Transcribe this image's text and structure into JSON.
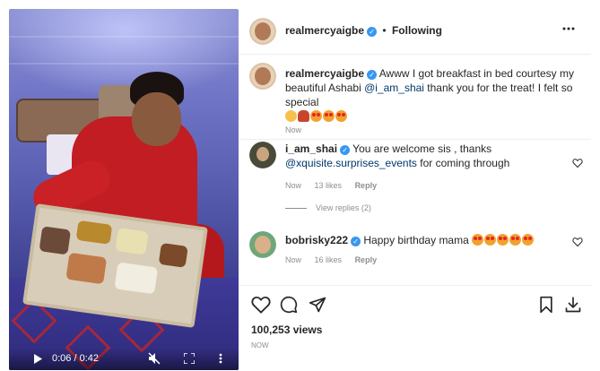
{
  "post": {
    "username": "realmercyaigbe",
    "follow_status": "Following",
    "separator": "•",
    "more_icon": "more-options-icon"
  },
  "caption": {
    "username": "realmercyaigbe",
    "text_before_mention": "Awww I got breakfast in bed courtesy my beautiful Ashabi ",
    "mention": "@i_am_shai",
    "text_after_mention": " thank you for the treat! I felt so special",
    "emojis": [
      "pleading-face",
      "person-tipping-hand",
      "heart-eyes",
      "heart-eyes",
      "heart-eyes"
    ],
    "time": "Now"
  },
  "comments": [
    {
      "username": "i_am_shai",
      "text_before_mention": "You are welcome sis , thanks ",
      "mention": "@xquisite.surprises_events",
      "text_after_mention": " for coming through",
      "time": "Now",
      "likes": "13 likes",
      "reply_label": "Reply",
      "view_replies": "View replies (2)"
    },
    {
      "username": "bobrisky222",
      "text": "Happy birthday mama",
      "emojis": [
        "heart-eyes",
        "heart-eyes",
        "heart-eyes",
        "heart-eyes",
        "heart-eyes"
      ],
      "time": "Now",
      "likes": "16 likes",
      "reply_label": "Reply"
    }
  ],
  "actions": {
    "views": "100,253 views",
    "timestamp": "NOW"
  },
  "video": {
    "current_time": "0:06",
    "separator": "/",
    "duration": "0:42",
    "progress_fraction": 0.143
  },
  "colors": {
    "verified_blue": "#3897f0",
    "mention_blue": "#00376b",
    "muted_gray": "#8e8e8e",
    "text_dark": "#262626"
  }
}
